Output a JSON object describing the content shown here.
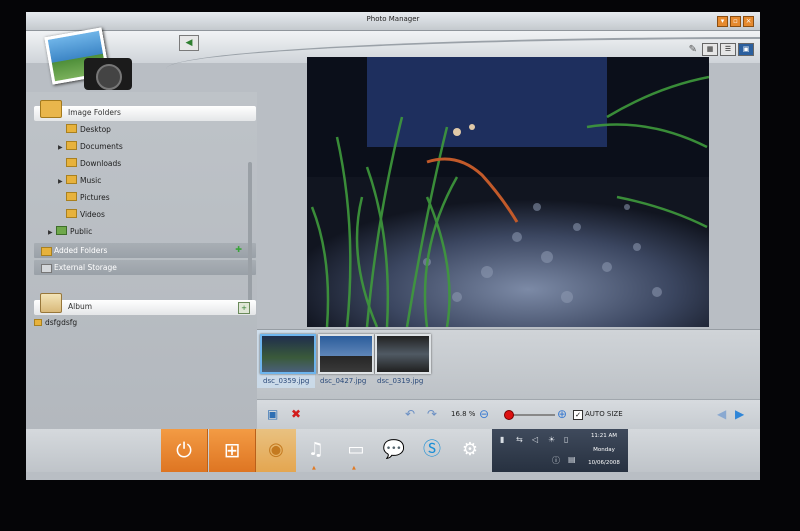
{
  "window": {
    "title": "Photo Manager"
  },
  "sidebar": {
    "image_folders_label": "Image Folders",
    "folders": [
      {
        "label": "Desktop",
        "expandable": false
      },
      {
        "label": "Documents",
        "expandable": true
      },
      {
        "label": "Downloads",
        "expandable": false
      },
      {
        "label": "Music",
        "expandable": true
      },
      {
        "label": "Pictures",
        "expandable": false
      },
      {
        "label": "Videos",
        "expandable": false
      }
    ],
    "public_label": "Public",
    "added_folders_label": "Added Folders",
    "external_storage_label": "External Storage",
    "album_label": "Album",
    "album_items": [
      "dsfgdsfg"
    ]
  },
  "thumbnails": [
    {
      "label": "dsc_0359.jpg",
      "selected": true
    },
    {
      "label": "dsc_0427.jpg",
      "selected": false
    },
    {
      "label": "dsc_0319.jpg",
      "selected": false
    }
  ],
  "toolbar": {
    "zoom_text": "16.8 %",
    "zoom_level": 0.05,
    "auto_size_checked": true,
    "auto_size_label": "AUTO SIZE"
  },
  "taskbar": {
    "time": "11:21 AM",
    "day": "Monday",
    "date": "10/06/2008"
  },
  "colors": {
    "accent_orange": "#e07a24",
    "selection_blue": "#6eb5ee",
    "tray_dark": "#273140"
  }
}
